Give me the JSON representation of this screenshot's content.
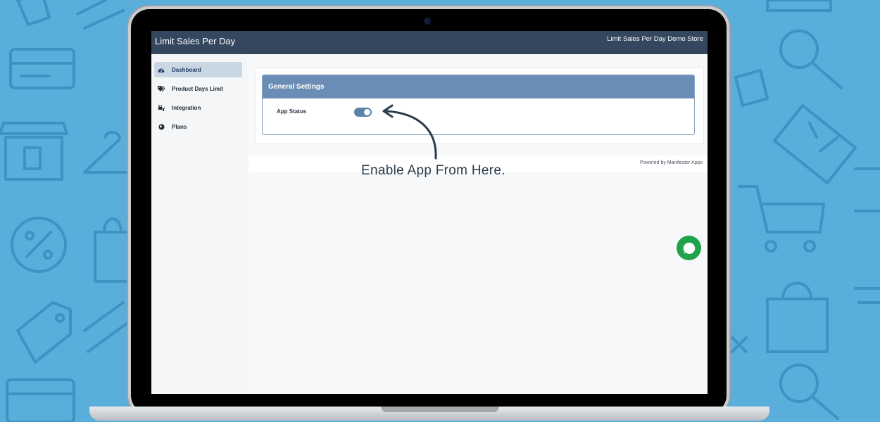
{
  "app": {
    "title": "Limit Sales Per Day",
    "store_name": "Limit Sales Per Day Demo Store"
  },
  "sidebar": {
    "items": [
      {
        "label": "Dashboard",
        "icon": "dashboard-gauge-icon",
        "active": true
      },
      {
        "label": "Product Days Limit",
        "icon": "tags-icon",
        "active": false
      },
      {
        "label": "Integration",
        "icon": "plug-icon",
        "active": false
      },
      {
        "label": "Plans",
        "icon": "globe-icon",
        "active": false
      }
    ]
  },
  "settings": {
    "panel_title": "General Settings",
    "app_status_label": "App Status",
    "app_status_enabled": true
  },
  "footer": {
    "powered_by": "Powered by",
    "powered_by_name": "Manifester Apps"
  },
  "annotation": {
    "text": "Enable App From Here."
  },
  "colors": {
    "background": "#5aaedb",
    "header": "#34475f",
    "panel_header": "#6a8db6",
    "toggle": "#5b82a8",
    "chat": "#1ea24a"
  }
}
